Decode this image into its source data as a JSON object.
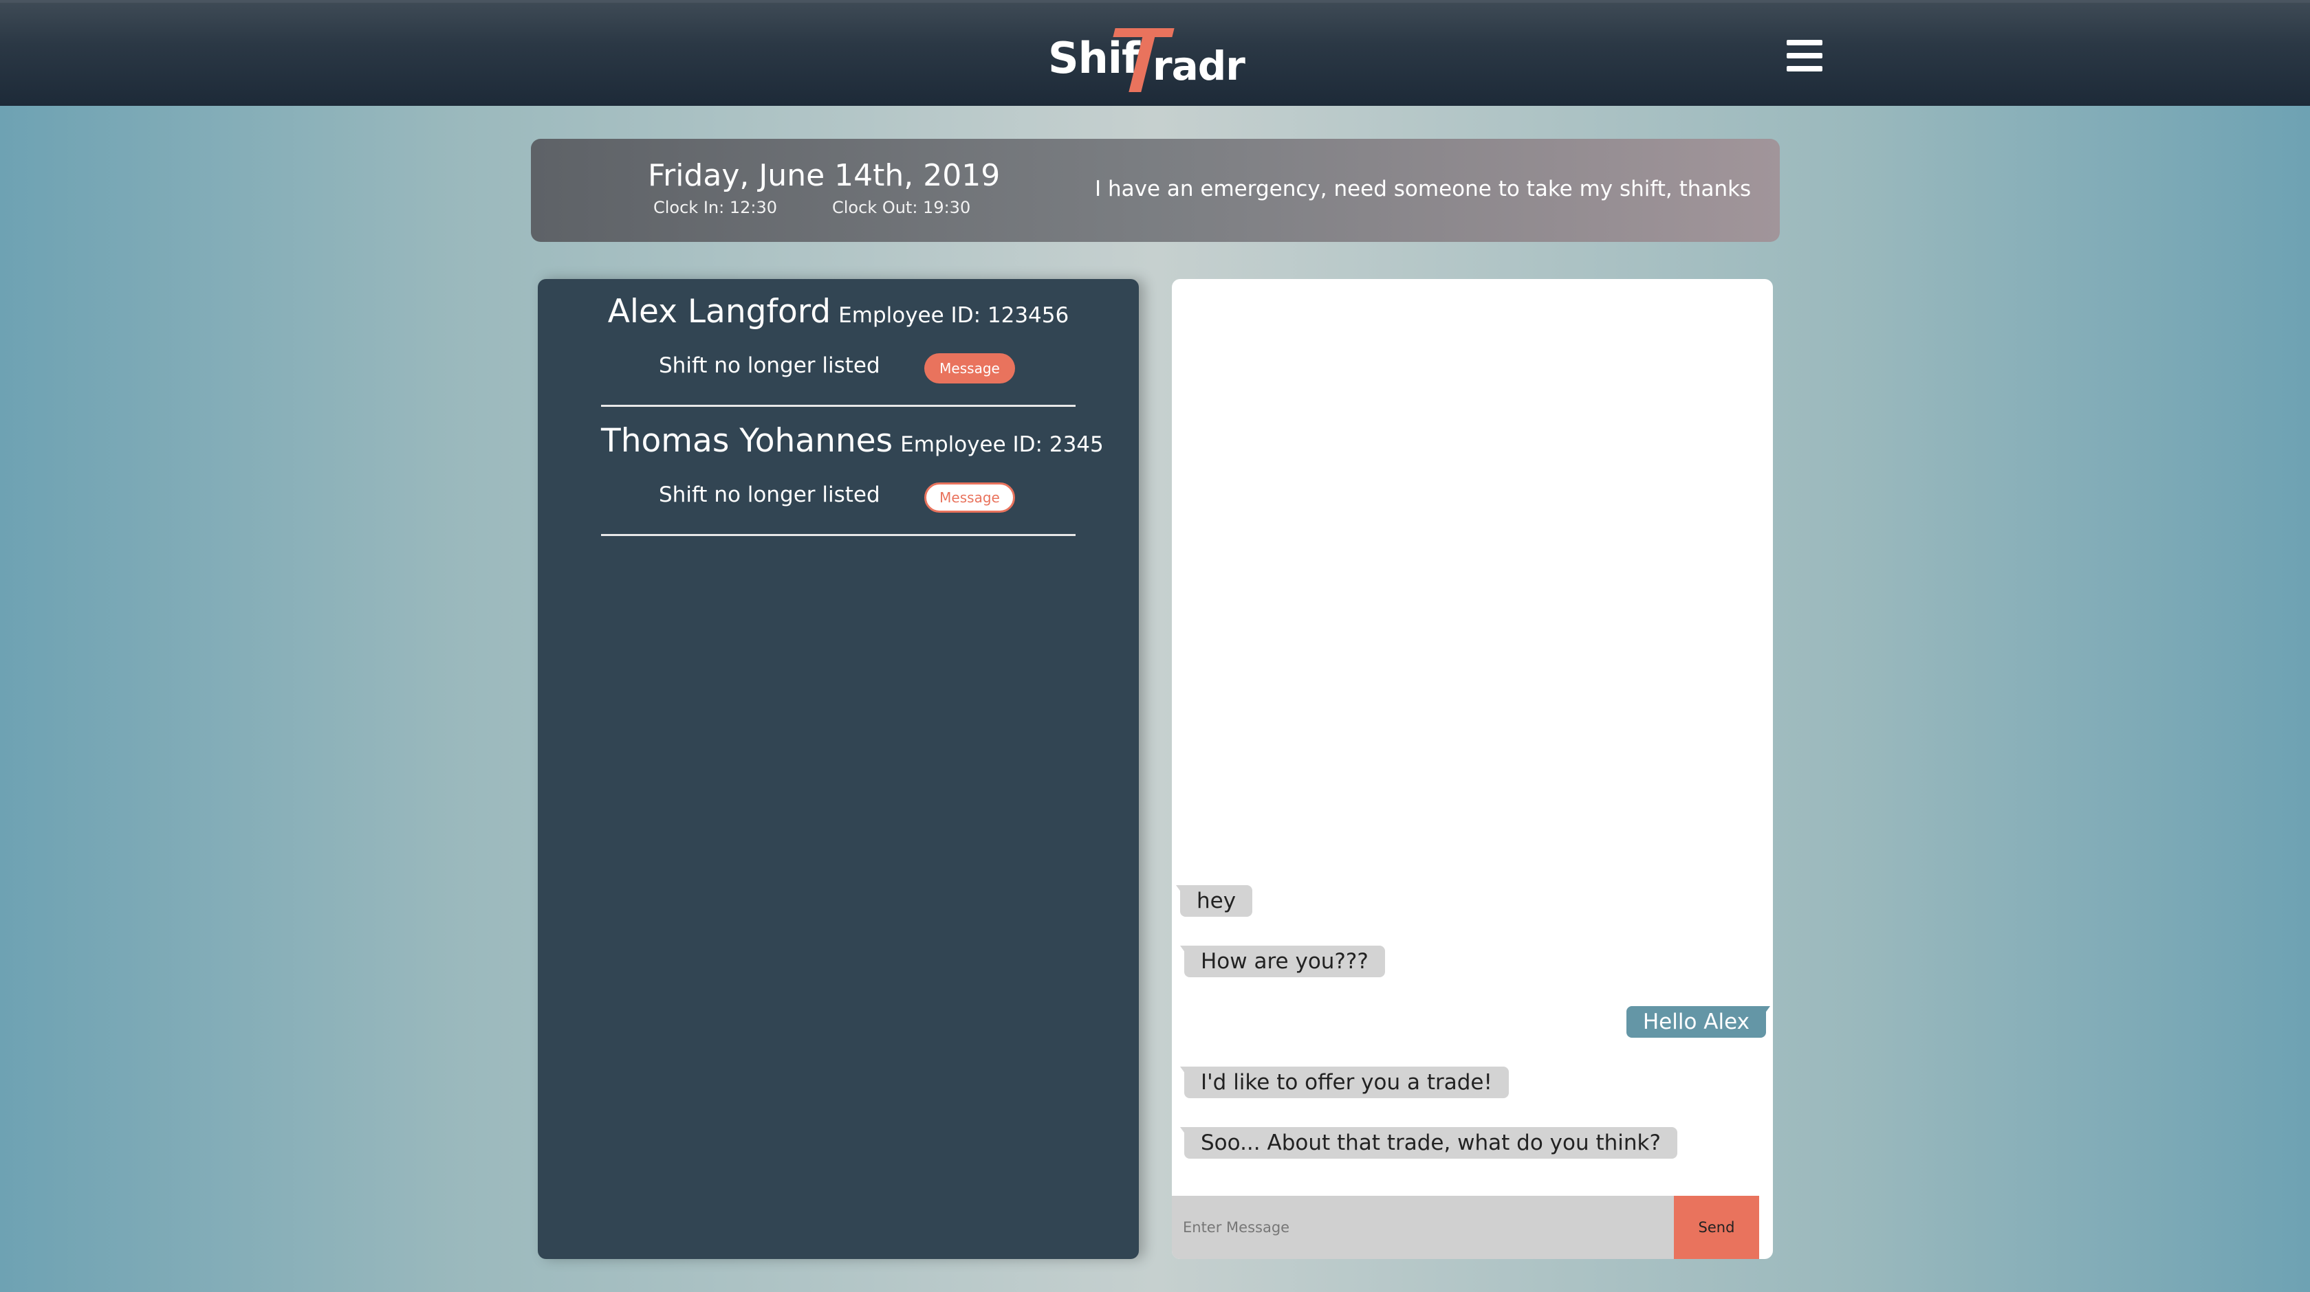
{
  "header": {
    "logo_text_left": "Shif",
    "logo_text_right": "radr",
    "logo_accent_letter": "T",
    "menu_icon": "hamburger-menu-icon"
  },
  "shift": {
    "date": "Friday, June 14th, 2019",
    "clock_in": "Clock In: 12:30",
    "clock_out": "Clock Out: 19:30",
    "note": "I have an emergency, need someone to take my shift, thanks"
  },
  "traders": [
    {
      "name": "Alex Langford",
      "employee_id": "Employee ID: 123456",
      "status": "Shift no longer listed",
      "message_label": "Message",
      "button_style": "filled"
    },
    {
      "name": "Thomas Yohannes",
      "employee_id": "Employee ID: 2345",
      "status": "Shift no longer listed",
      "message_label": "Message",
      "button_style": "outline"
    }
  ],
  "chat": {
    "messages": [
      {
        "text": "hey",
        "direction": "incoming"
      },
      {
        "text": "How are you???",
        "direction": "incoming"
      },
      {
        "text": "Hello Alex",
        "direction": "outgoing"
      },
      {
        "text": "I'd like to offer you a trade!",
        "direction": "incoming"
      },
      {
        "text": "Soo... About that trade, what do you think?",
        "direction": "incoming"
      }
    ],
    "input_placeholder": "Enter Message",
    "input_value": "",
    "send_label": "Send"
  },
  "colors": {
    "accent": "#e9735d",
    "panel_dark": "#324553",
    "outgoing_bubble": "#6496a6",
    "incoming_bubble": "#d3d3d3"
  }
}
